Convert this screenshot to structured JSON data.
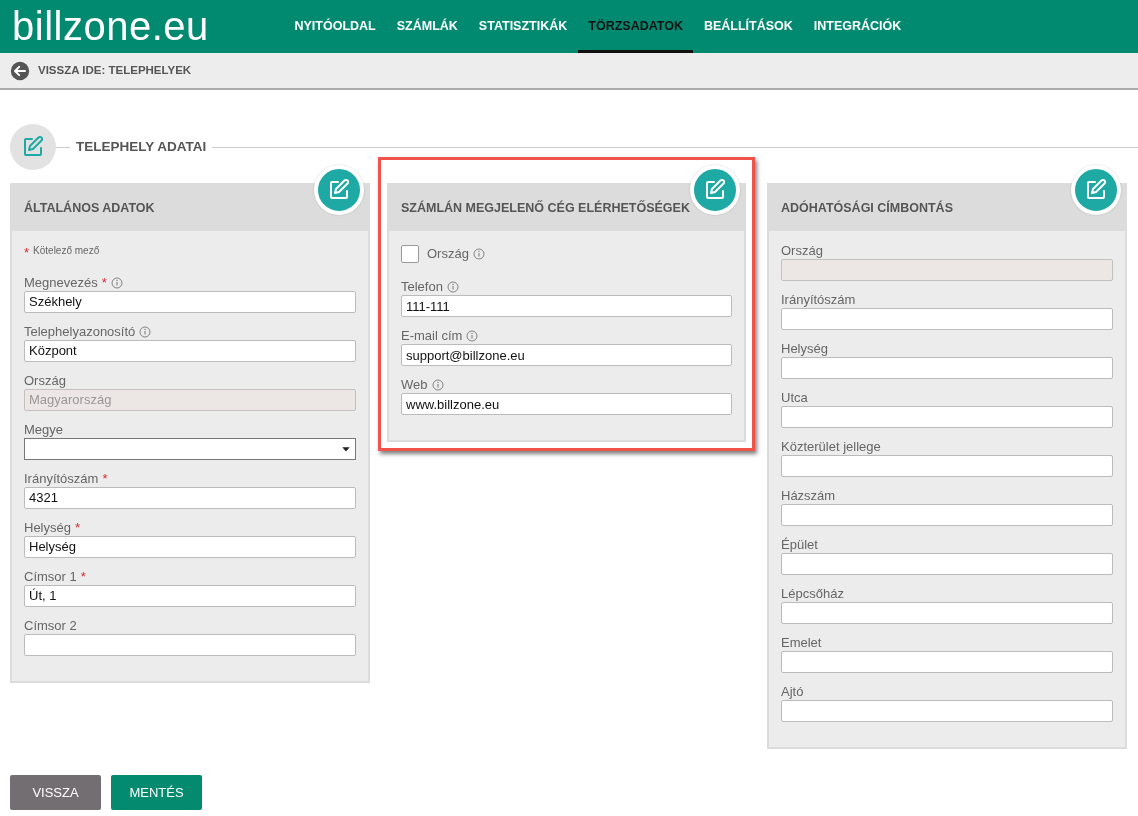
{
  "header": {
    "logo": "billzone.eu",
    "nav": [
      {
        "label": "NYITÓOLDAL",
        "selected": false
      },
      {
        "label": "SZÁMLÁK",
        "selected": false
      },
      {
        "label": "STATISZTIKÁK",
        "selected": false
      },
      {
        "label": "TÖRZSADATOK",
        "selected": true
      },
      {
        "label": "BEÁLLÍTÁSOK",
        "selected": false
      },
      {
        "label": "INTEGRÁCIÓK",
        "selected": false
      }
    ]
  },
  "back_link": {
    "label": "VISSZA IDE: TELEPHELYEK"
  },
  "section": {
    "title": "TELEPHELY ADATAI"
  },
  "panels": [
    {
      "title": "ÁLTALÁNOS ADATOK",
      "highlighted": false,
      "required_note": {
        "mark": "*",
        "text": "Kötelező mező"
      },
      "fields": [
        {
          "kind": "text",
          "label": "Megnevezés",
          "required_mark": "*",
          "info": true,
          "value": "Székhely",
          "disabled": false
        },
        {
          "kind": "text",
          "label": "Telephelyazonosító",
          "info": true,
          "value": "Központ",
          "disabled": false
        },
        {
          "kind": "text",
          "label": "Ország",
          "info": false,
          "value": "Magyarország",
          "disabled": true
        },
        {
          "kind": "select",
          "label": "Megye",
          "info": false
        },
        {
          "kind": "text",
          "label": "Irányítószám",
          "required_mark": "*",
          "info": false,
          "value": "4321",
          "disabled": false
        },
        {
          "kind": "text",
          "label": "Helység",
          "required_mark": "*",
          "info": false,
          "value": "Helység",
          "disabled": false
        },
        {
          "kind": "text",
          "label": "Címsor 1",
          "required_mark": "*",
          "info": false,
          "value": "Út, 1",
          "disabled": false
        },
        {
          "kind": "text",
          "label": "Címsor 2",
          "info": false,
          "disabled": false
        }
      ]
    },
    {
      "title": "SZÁMLÁN MEGJELENŐ CÉG ELÉRHETŐSÉGEK",
      "highlighted": true,
      "fields": [
        {
          "kind": "checkbox",
          "label": "Ország",
          "info": true,
          "checked": false
        },
        {
          "kind": "text",
          "label": "Telefon",
          "info": true,
          "value": "111-111",
          "disabled": false
        },
        {
          "kind": "text",
          "label": "E-mail cím",
          "info": true,
          "value": "support@billzone.eu",
          "disabled": false
        },
        {
          "kind": "text",
          "label": "Web",
          "info": true,
          "value": "www.billzone.eu",
          "disabled": false
        }
      ]
    },
    {
      "title": "ADÓHATÓSÁGI CÍMBONTÁS",
      "highlighted": false,
      "fields": [
        {
          "kind": "text",
          "label": "Ország",
          "info": false,
          "disabled": true
        },
        {
          "kind": "text",
          "label": "Irányítószám",
          "info": false,
          "disabled": false
        },
        {
          "kind": "text",
          "label": "Helység",
          "info": false,
          "disabled": false
        },
        {
          "kind": "text",
          "label": "Utca",
          "info": false,
          "disabled": false
        },
        {
          "kind": "text",
          "label": "Közterület jellege",
          "info": false,
          "disabled": false
        },
        {
          "kind": "text",
          "label": "Házszám",
          "info": false,
          "disabled": false
        },
        {
          "kind": "text",
          "label": "Épület",
          "info": false,
          "disabled": false
        },
        {
          "kind": "text",
          "label": "Lépcsőház",
          "info": false,
          "disabled": false
        },
        {
          "kind": "text",
          "label": "Emelet",
          "info": false,
          "disabled": false
        },
        {
          "kind": "text",
          "label": "Ajtó",
          "info": false,
          "disabled": false
        }
      ]
    }
  ],
  "buttons": [
    {
      "label": "VISSZA",
      "kind": "secondary"
    },
    {
      "label": "MENTÉS",
      "kind": "primary"
    }
  ]
}
